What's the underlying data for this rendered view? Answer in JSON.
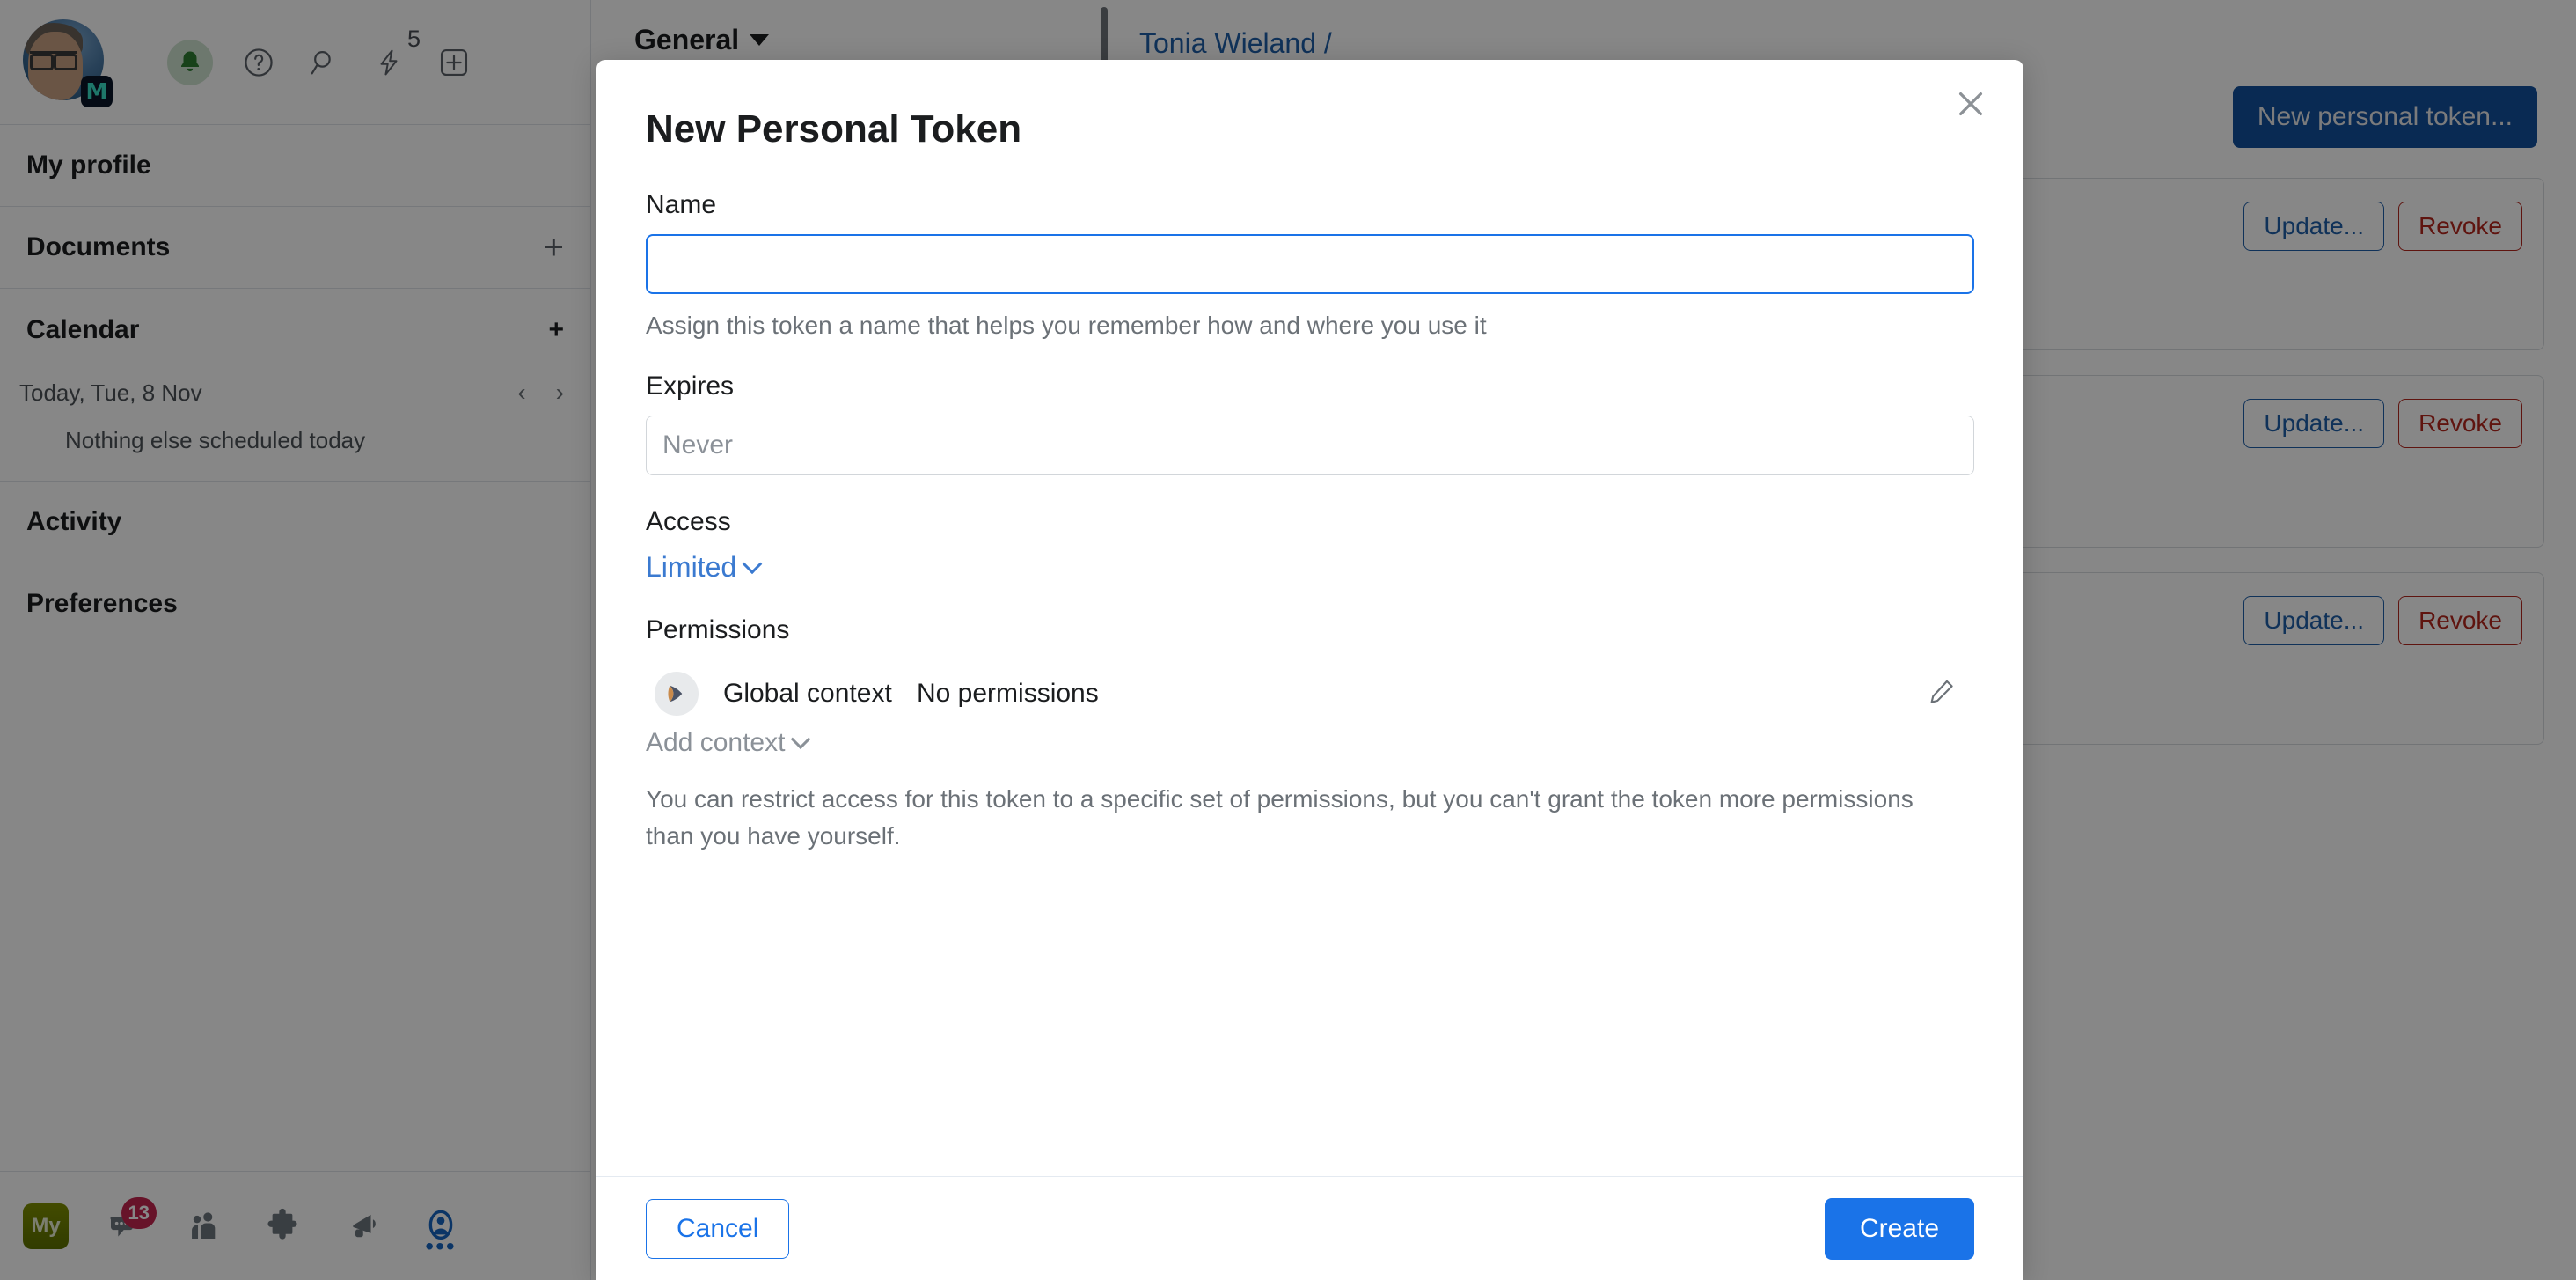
{
  "sidebar": {
    "profile": {
      "avatar_name": "user-avatar",
      "badge_letter": "M"
    },
    "header_icons": [
      {
        "name": "notifications-bell-icon",
        "label": "Notifications",
        "superscript": ""
      },
      {
        "name": "help-question-icon",
        "label": "Help",
        "superscript": ""
      },
      {
        "name": "search-icon",
        "label": "Search",
        "superscript": ""
      },
      {
        "name": "quick-actions-lightning-icon",
        "label": "Quick actions",
        "superscript": "5"
      },
      {
        "name": "add-new-icon",
        "label": "New",
        "superscript": ""
      }
    ],
    "items": [
      {
        "label": "My profile",
        "has_add": false
      },
      {
        "label": "Documents",
        "has_add": true
      },
      {
        "label": "Calendar",
        "has_add": true
      },
      {
        "label": "Activity",
        "has_add": false
      },
      {
        "label": "Preferences",
        "has_add": false
      }
    ],
    "calendar": {
      "date_label": "Today, Tue, 8 Nov",
      "prev_label": "‹",
      "next_label": "›",
      "empty_message": "Nothing else scheduled today"
    },
    "bottom_bar": {
      "my_chip": "My",
      "icons": [
        {
          "name": "chat-bubble-icon",
          "badge": "13"
        },
        {
          "name": "people-icon",
          "badge": ""
        },
        {
          "name": "puzzle-piece-icon",
          "badge": ""
        },
        {
          "name": "megaphone-icon",
          "badge": ""
        },
        {
          "name": "user-account-icon",
          "badge": ""
        }
      ],
      "overflow_dots": "•••"
    }
  },
  "main": {
    "topbar": {
      "general_menu": "General",
      "breadcrumb_link": "Tonia Wieland /"
    },
    "new_token_button": "New personal token...",
    "token_rows": [
      {
        "update_label": "Update...",
        "revoke_label": "Revoke"
      },
      {
        "update_label": "Update...",
        "revoke_label": "Revoke"
      },
      {
        "update_label": "Update...",
        "revoke_label": "Revoke"
      }
    ]
  },
  "modal": {
    "title": "New Personal Token",
    "close_label": "Close",
    "name": {
      "label": "Name",
      "value": "",
      "placeholder": "",
      "help": "Assign this token a name that helps you remember how and where you use it"
    },
    "expires": {
      "label": "Expires",
      "value": "",
      "placeholder": "Never"
    },
    "access": {
      "label": "Access",
      "selected": "Limited"
    },
    "permissions": {
      "label": "Permissions",
      "rows": [
        {
          "context": "Global context",
          "value": "No permissions",
          "edit_label": "Edit"
        }
      ],
      "add_context": "Add context",
      "help": "You can restrict access for this token to a specific set of permissions, but you can't grant the token more permissions than you have yourself."
    },
    "footer": {
      "cancel": "Cancel",
      "create": "Create"
    }
  },
  "colors": {
    "accent_blue": "#1a73e8",
    "link_blue": "#1f5fa8",
    "danger_red": "#b3261e",
    "primary_dark_blue": "#12509e",
    "badge_red": "#c3254f",
    "bell_green": "#2e7d32"
  }
}
